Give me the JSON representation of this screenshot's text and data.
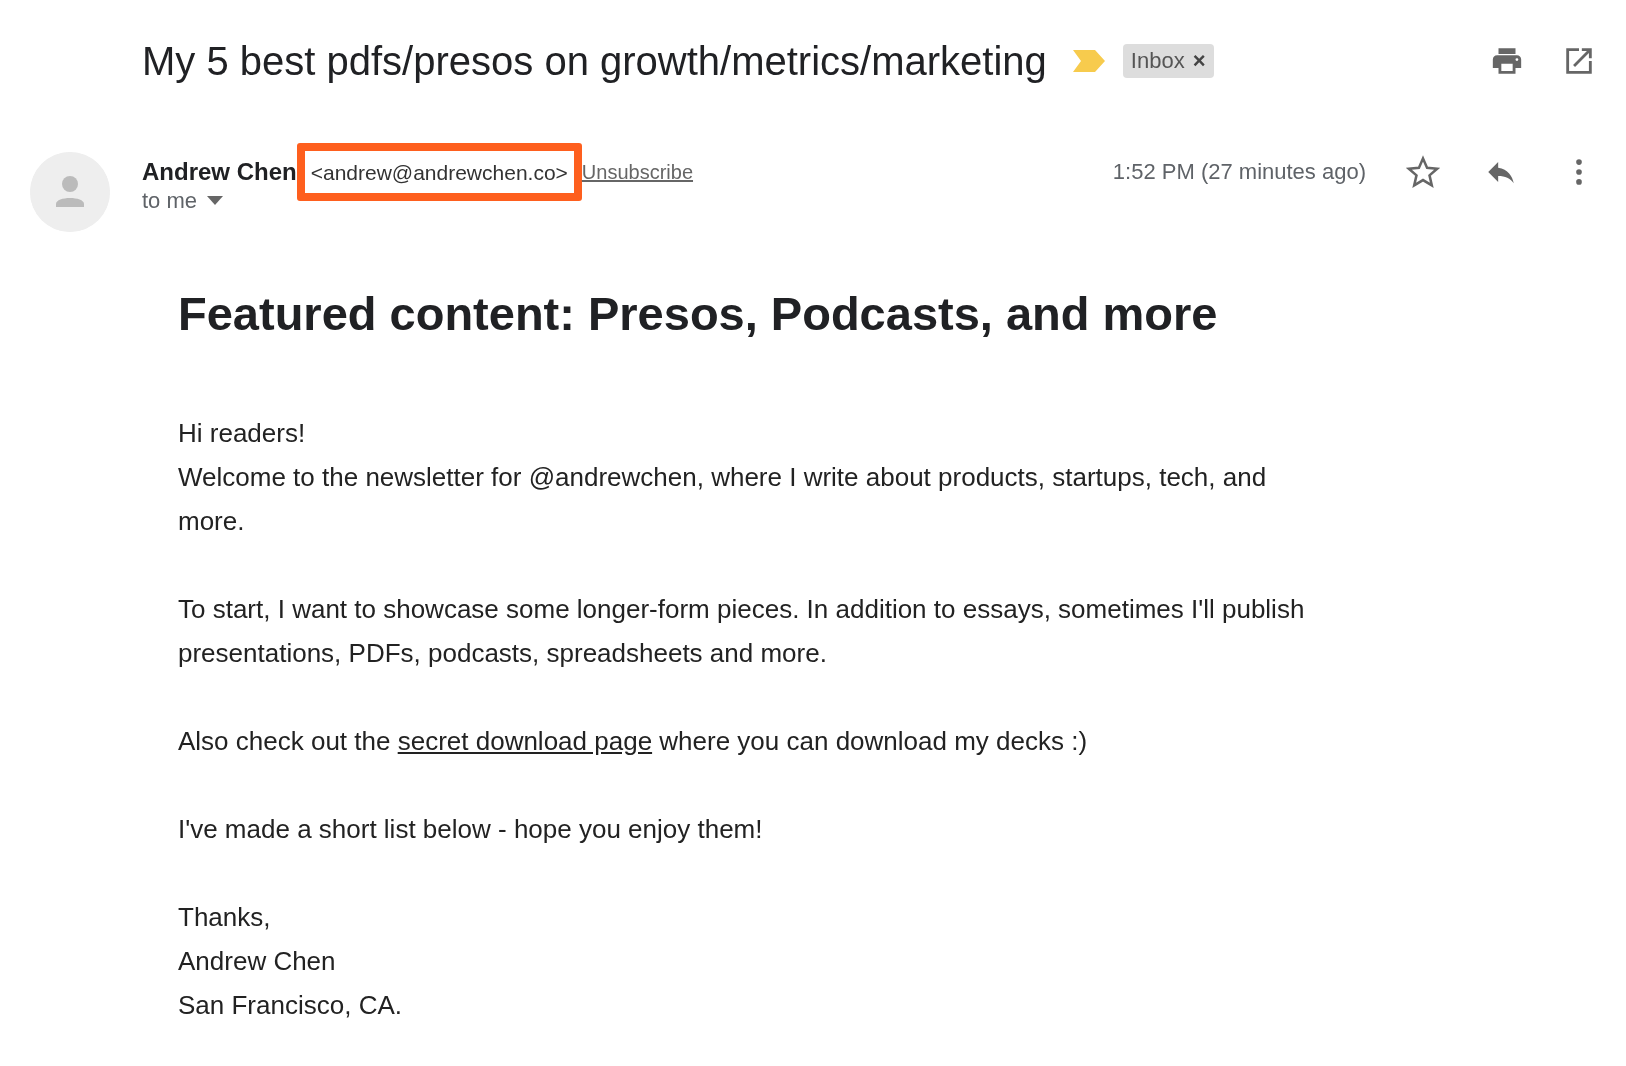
{
  "subject": "My 5 best pdfs/presos on growth/metrics/marketing",
  "label": {
    "text": "Inbox",
    "remove": "×"
  },
  "sender": {
    "name": "Andrew Chen",
    "email": "<andrew@andrewchen.co>",
    "highlighted": true,
    "unsubscribe": "Unsubscribe",
    "recipient": "to me",
    "time": "1:52 PM (27 minutes ago)",
    "starred": false
  },
  "body": {
    "heading": "Featured content: Presos, Podcasts, and more",
    "paragraphs": [
      {
        "lines": [
          {
            "before": "Hi readers!"
          },
          {
            "before": "Welcome to the newsletter for @andrewchen, where I write about products, startups, tech, and more."
          }
        ]
      },
      {
        "lines": [
          {
            "before": "To start, I want to showcase some longer-form pieces. In addition to essays, sometimes I'll publish presentations, PDFs, podcasts, spreadsheets and more."
          }
        ]
      },
      {
        "lines": [
          {
            "before": "Also check out the ",
            "link": "secret download page",
            "after": " where you can download my decks :)"
          }
        ]
      },
      {
        "lines": [
          {
            "before": "I've made a short list below - hope you enjoy them!"
          }
        ]
      },
      {
        "lines": [
          {
            "before": "Thanks,"
          },
          {
            "before": "Andrew Chen"
          },
          {
            "before": "San Francisco, CA."
          }
        ]
      }
    ]
  }
}
